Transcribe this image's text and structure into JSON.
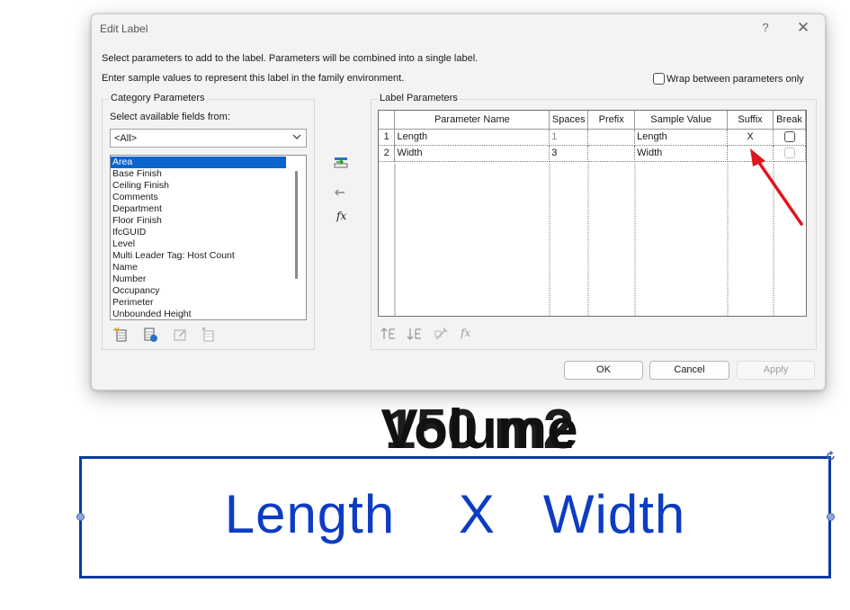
{
  "dialog": {
    "title": "Edit Label",
    "help_symbol": "?",
    "close_symbol": "✕",
    "instruction_1": "Select parameters to add to the label.  Parameters will be combined into a single label.",
    "instruction_2": "Enter sample values to represent this label in the family environment.",
    "wrap_label": "Wrap between parameters only",
    "wrap_checked": false
  },
  "category_panel": {
    "legend": "Category Parameters",
    "select_label": "Select available fields from:",
    "filter_value": "<All>",
    "items": [
      "Area",
      "Base Finish",
      "Ceiling Finish",
      "Comments",
      "Department",
      "Floor Finish",
      "IfcGUID",
      "Level",
      "Multi Leader Tag: Host Count",
      "Name",
      "Number",
      "Occupancy",
      "Perimeter",
      "Unbounded Height"
    ],
    "selected_item": "Area"
  },
  "middle_tools": {
    "add_icon": "add-parameter-icon",
    "remove_icon": "remove-parameter-icon",
    "formula_label": "fx"
  },
  "label_panel": {
    "legend": "Label Parameters",
    "columns": [
      "Parameter Name",
      "Spaces",
      "Prefix",
      "Sample Value",
      "Suffix",
      "Break"
    ],
    "rows": [
      {
        "num": "1",
        "name": "Length",
        "spaces": "1",
        "prefix": "",
        "sample": "Length",
        "suffix": "X",
        "break": false
      },
      {
        "num": "2",
        "name": "Width",
        "spaces": "3",
        "prefix": "",
        "sample": "Width",
        "suffix": "",
        "break": false
      }
    ],
    "formula_tool": "fx"
  },
  "buttons": {
    "ok": "OK",
    "cancel": "Cancel",
    "apply": "Apply"
  },
  "canvas": {
    "overlap_text_a": "Volume",
    "overlap_text_b": "150 m2",
    "label_text": "Length    X   Width",
    "accent_color": "#0d3cc4",
    "arrow_color": "#e0141d"
  }
}
